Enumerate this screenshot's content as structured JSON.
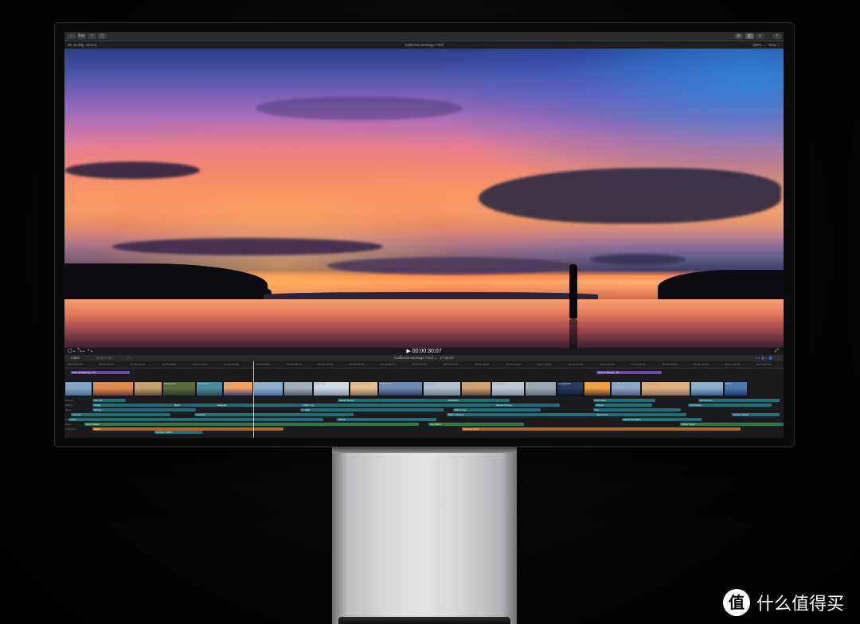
{
  "toolbar": {
    "buttons": [
      "↓",
      "Key",
      "□",
      "◫"
    ],
    "right": [
      "▤",
      "◧",
      "≡",
      "⇪"
    ]
  },
  "viewer_bar": {
    "format": "8K 23.98p, Stereo",
    "title": "California Montage Final",
    "zoom": "100% ⌄",
    "view": "View ⌄"
  },
  "playback": {
    "timecode": "00:00:30:07",
    "play_symbol": "▶"
  },
  "timeline_bar": {
    "index": "Index",
    "project": "California Montage Final ⌄",
    "duration": "17:10:07"
  },
  "ruler_ticks": [
    "00:00:00:00",
    "00:00:05:00",
    "00:00:10:00",
    "00:00:15:00",
    "00:00:20:00",
    "00:00:25:00",
    "00:00:30:00",
    "00:00:35:00",
    "00:00:40:00",
    "00:00:45:00",
    "00:00:50:00",
    "00:00:55:00",
    "00:01:00:00",
    "00:01:05:00",
    "00:01:10:00",
    "00:01:15:00",
    "00:01:20:00",
    "00:01:25:00",
    "00:01:30:00",
    "00:01:35:00",
    "00:01:40:00",
    "00:01:45:00",
    "00:01:50:00",
    "00:01:55:00"
  ],
  "purple_bars": [
    "Best of California - 02",
    "Best of Wheels - 02"
  ],
  "clips": [
    "Misty Ocean",
    "Lands End Sunset",
    "Island Sunrise",
    "Redwoods",
    "South Shore",
    "Big Sur",
    "Lake Tahoe",
    "Emerald Bay",
    "Ferry Ride",
    "Palace of Fine Arts",
    "Mission Bay",
    "Bay Bridge",
    "Civic Center",
    "Golden Gate",
    "Marin",
    "Lombard St",
    "Gold Sunset",
    "SF City Hall",
    "Sunset Beach",
    "Big Sur",
    "Tahoe"
  ],
  "audio_tracks": [
    "Intro 02",
    "Narrator Pacific",
    "Surf Ambience",
    "Elastic Sound",
    "Chill Wind",
    "Chill Vibes",
    "Surf Sunset",
    "Whale",
    "Birds",
    "Seagulls",
    "Traffic City",
    "Waves",
    "Surf Fiesta",
    "Strings",
    "Ocean",
    "Wind Loop",
    "City",
    "City Life",
    "Seagulls",
    "Water Lapping",
    "Sweet Surf",
    "Horizon Music",
    "Wind",
    "Waves",
    "Sand Sweep",
    "City Plains",
    "Street Music",
    "Beach",
    "Summer Glow",
    "Market",
    "Sweet Sunshine",
    "Sunset Chorus"
  ],
  "row_labels": [
    "Ambient",
    "Effects",
    "Music",
    "Dialog",
    "Voice",
    "Ambience"
  ]
}
